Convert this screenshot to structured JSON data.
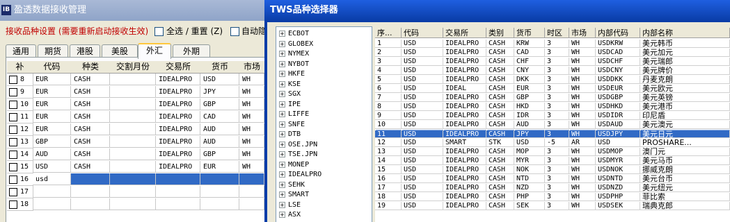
{
  "left_window": {
    "title": "盈透数据接收管理",
    "app_icon": "IB",
    "settings_label": "接收品种设置 (需要重新启动接收生效)",
    "select_all_label": "全选 / 重置 (Z)",
    "auto_label": "自动隐",
    "tabs": [
      "通用",
      "期货",
      "港股",
      "美股",
      "外汇",
      "外期"
    ],
    "active_tab": "外汇",
    "columns": [
      "补",
      "代码",
      "种类",
      "交割月份",
      "交易所",
      "货币",
      "市场"
    ],
    "rows": [
      {
        "num": "8",
        "code": "EUR",
        "type": "CASH",
        "month": "",
        "exchange": "IDEALPRO",
        "currency": "USD",
        "market": "WH"
      },
      {
        "num": "9",
        "code": "EUR",
        "type": "CASH",
        "month": "",
        "exchange": "IDEALPRO",
        "currency": "JPY",
        "market": "WH"
      },
      {
        "num": "10",
        "code": "EUR",
        "type": "CASH",
        "month": "",
        "exchange": "IDEALPRO",
        "currency": "GBP",
        "market": "WH"
      },
      {
        "num": "11",
        "code": "EUR",
        "type": "CASH",
        "month": "",
        "exchange": "IDEALPRO",
        "currency": "CAD",
        "market": "WH"
      },
      {
        "num": "12",
        "code": "EUR",
        "type": "CASH",
        "month": "",
        "exchange": "IDEALPRO",
        "currency": "AUD",
        "market": "WH"
      },
      {
        "num": "13",
        "code": "GBP",
        "type": "CASH",
        "month": "",
        "exchange": "IDEALPRO",
        "currency": "AUD",
        "market": "WH"
      },
      {
        "num": "14",
        "code": "AUD",
        "type": "CASH",
        "month": "",
        "exchange": "IDEALPRO",
        "currency": "GBP",
        "market": "WH"
      },
      {
        "num": "15",
        "code": "USD",
        "type": "CASH",
        "month": "",
        "exchange": "IDEALPRO",
        "currency": "EUR",
        "market": "WH"
      },
      {
        "num": "16",
        "code": "usd",
        "type": "",
        "month": "",
        "exchange": "",
        "currency": "",
        "market": ""
      },
      {
        "num": "17",
        "code": "",
        "type": "",
        "month": "",
        "exchange": "",
        "currency": "",
        "market": ""
      },
      {
        "num": "18",
        "code": "",
        "type": "",
        "month": "",
        "exchange": "",
        "currency": "",
        "market": ""
      }
    ]
  },
  "right_window": {
    "title": "TWS品种选择器",
    "tree_items": [
      "ECBOT",
      "GLOBEX",
      "NYMEX",
      "NYBOT",
      "HKFE",
      "KSE",
      "SGX",
      "IPE",
      "LIFFE",
      "SNFE",
      "DTB",
      "OSE.JPN",
      "TSE.JPN",
      "MONEP",
      "IDEALPRO",
      "SEHK",
      "SMART",
      "LSE",
      "ASX"
    ],
    "columns": [
      "序...",
      "代码",
      "交易所",
      "类别",
      "货币",
      "时区",
      "市场",
      "内部代码",
      "内部名称"
    ],
    "rows": [
      {
        "seq": "1",
        "code": "USD",
        "exchange": "IDEALPRO",
        "category": "CASH",
        "currency": "KRW",
        "tz": "3",
        "market": "WH",
        "internal_code": "USDKRW",
        "internal_name": "美元韩币"
      },
      {
        "seq": "2",
        "code": "USD",
        "exchange": "IDEALPRO",
        "category": "CASH",
        "currency": "CAD",
        "tz": "3",
        "market": "WH",
        "internal_code": "USDCAD",
        "internal_name": "美元加元"
      },
      {
        "seq": "3",
        "code": "USD",
        "exchange": "IDEALPRO",
        "category": "CASH",
        "currency": "CHF",
        "tz": "3",
        "market": "WH",
        "internal_code": "USDCHF",
        "internal_name": "美元瑞郎"
      },
      {
        "seq": "4",
        "code": "USD",
        "exchange": "IDEALPRO",
        "category": "CASH",
        "currency": "CNY",
        "tz": "3",
        "market": "WH",
        "internal_code": "USDCNY",
        "internal_name": "美元牌价"
      },
      {
        "seq": "5",
        "code": "USD",
        "exchange": "IDEALPRO",
        "category": "CASH",
        "currency": "DKK",
        "tz": "3",
        "market": "WH",
        "internal_code": "USDDKK",
        "internal_name": "丹麦克朗"
      },
      {
        "seq": "6",
        "code": "USD",
        "exchange": "IDEAL",
        "category": "CASH",
        "currency": "EUR",
        "tz": "3",
        "market": "WH",
        "internal_code": "USDEUR",
        "internal_name": "美元欧元"
      },
      {
        "seq": "7",
        "code": "USD",
        "exchange": "IDEALPRO",
        "category": "CASH",
        "currency": "GBP",
        "tz": "3",
        "market": "WH",
        "internal_code": "USDGBP",
        "internal_name": "美元英镑"
      },
      {
        "seq": "8",
        "code": "USD",
        "exchange": "IDEALPRO",
        "category": "CASH",
        "currency": "HKD",
        "tz": "3",
        "market": "WH",
        "internal_code": "USDHKD",
        "internal_name": "美元港币"
      },
      {
        "seq": "9",
        "code": "USD",
        "exchange": "IDEALPRO",
        "category": "CASH",
        "currency": "IDR",
        "tz": "3",
        "market": "WH",
        "internal_code": "USDIDR",
        "internal_name": "印尼盾"
      },
      {
        "seq": "10",
        "code": "USD",
        "exchange": "IDEALPRO",
        "category": "CASH",
        "currency": "AUD",
        "tz": "3",
        "market": "WH",
        "internal_code": "USDAUD",
        "internal_name": "美元澳元"
      },
      {
        "seq": "11",
        "code": "USD",
        "exchange": "IDEALPRO",
        "category": "CASH",
        "currency": "JPY",
        "tz": "3",
        "market": "WH",
        "internal_code": "USDJPY",
        "internal_name": "美元日元"
      },
      {
        "seq": "12",
        "code": "USD",
        "exchange": "SMART",
        "category": "STK",
        "currency": "USD",
        "tz": "-5",
        "market": "AR",
        "internal_code": "USD",
        "internal_name": "PROSHARE..."
      },
      {
        "seq": "13",
        "code": "USD",
        "exchange": "IDEALPRO",
        "category": "CASH",
        "currency": "MOP",
        "tz": "3",
        "market": "WH",
        "internal_code": "USDMOP",
        "internal_name": "澳门元"
      },
      {
        "seq": "14",
        "code": "USD",
        "exchange": "IDEALPRO",
        "category": "CASH",
        "currency": "MYR",
        "tz": "3",
        "market": "WH",
        "internal_code": "USDMYR",
        "internal_name": "美元马币"
      },
      {
        "seq": "15",
        "code": "USD",
        "exchange": "IDEALPRO",
        "category": "CASH",
        "currency": "NOK",
        "tz": "3",
        "market": "WH",
        "internal_code": "USDNOK",
        "internal_name": "挪威克朗"
      },
      {
        "seq": "16",
        "code": "USD",
        "exchange": "IDEALPRO",
        "category": "CASH",
        "currency": "NTD",
        "tz": "3",
        "market": "WH",
        "internal_code": "USDNTD",
        "internal_name": "美元台币"
      },
      {
        "seq": "17",
        "code": "USD",
        "exchange": "IDEALPRO",
        "category": "CASH",
        "currency": "NZD",
        "tz": "3",
        "market": "WH",
        "internal_code": "USDNZD",
        "internal_name": "美元纽元"
      },
      {
        "seq": "18",
        "code": "USD",
        "exchange": "IDEALPRO",
        "category": "CASH",
        "currency": "PHP",
        "tz": "3",
        "market": "WH",
        "internal_code": "USDPHP",
        "internal_name": "菲比索"
      },
      {
        "seq": "19",
        "code": "USD",
        "exchange": "IDEALPRO",
        "category": "CASH",
        "currency": "SEK",
        "tz": "3",
        "market": "WH",
        "internal_code": "USDSEK",
        "internal_name": "瑞典克郎"
      }
    ],
    "selected_row": 10
  },
  "colors": {
    "selection": "#316ac5",
    "title_active": "#0a3da8",
    "title_inactive": "#8fa4c8",
    "settings_label": "#c00000",
    "active_tab_accent": "#ffc73c"
  },
  "icons": {
    "tree_expand": "plus-box-icon",
    "app": "ib-app-icon"
  }
}
